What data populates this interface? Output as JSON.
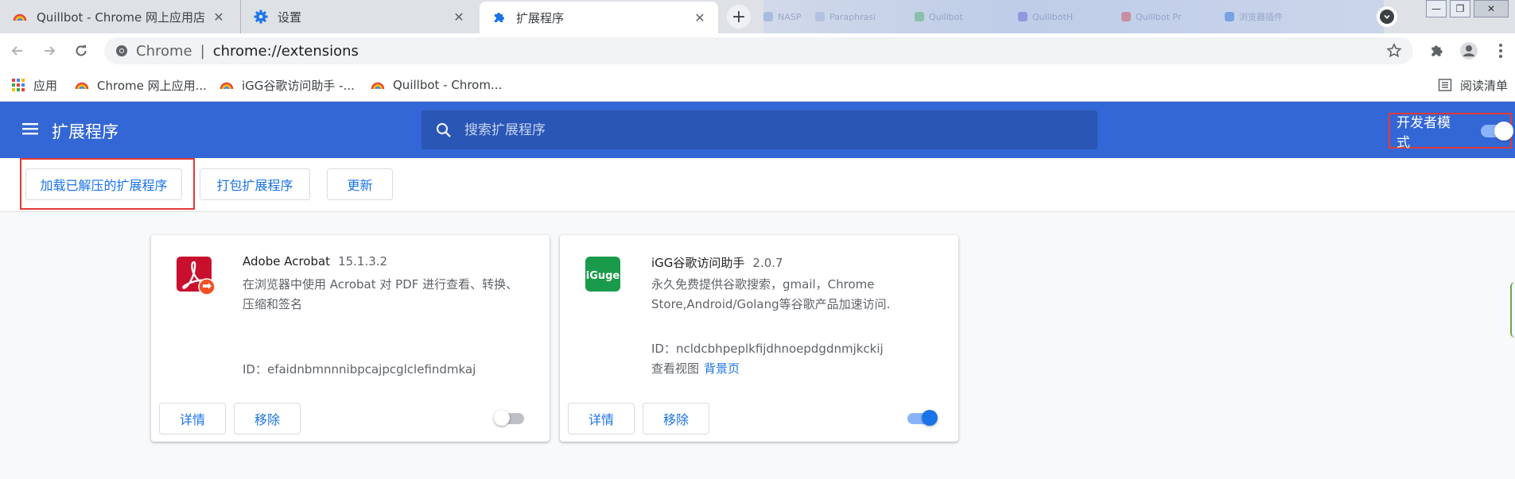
{
  "tabs": [
    {
      "label": "Quillbot - Chrome 网上应用店",
      "icon": "quillbot-rainbow-icon"
    },
    {
      "label": "设置",
      "icon": "gear-icon"
    },
    {
      "label": "扩展程序",
      "icon": "puzzle-icon",
      "active": true
    }
  ],
  "background_tabs": [
    "NASP",
    "Paraphrasi",
    "Quillbot",
    "QuillbotH",
    "Quillbot Pr",
    "浏览器插件"
  ],
  "address": {
    "site": "Chrome",
    "separator": "|",
    "url": "chrome://extensions"
  },
  "bookmarks": [
    {
      "label": "应用",
      "icon": "apps-grid-icon"
    },
    {
      "label": "Chrome 网上应用...",
      "icon": "rainbow-icon"
    },
    {
      "label": "iGG谷歌访问助手 -...",
      "icon": "rainbow-icon"
    },
    {
      "label": "Quillbot - Chrom...",
      "icon": "rainbow-icon"
    }
  ],
  "reading_list": "阅读清单",
  "header": {
    "title": "扩展程序",
    "search_placeholder": "搜索扩展程序",
    "dev_mode_label": "开发者模式",
    "dev_mode_on": true
  },
  "actions": {
    "load_unpacked": "加载已解压的扩展程序",
    "pack": "打包扩展程序",
    "update": "更新"
  },
  "extensions": [
    {
      "name": "Adobe Acrobat",
      "version": "15.1.3.2",
      "description": "在浏览器中使用 Acrobat 对 PDF 进行查看、转换、压缩和签名",
      "id": "ID：efaidnbmnnnibpcajpcglclefindmkaj",
      "details": "详情",
      "remove": "移除",
      "enabled": false
    },
    {
      "name": "iGG谷歌访问助手",
      "version": "2.0.7",
      "description": "永久免费提供谷歌搜索，gmail，Chrome Store,Android/Golang等谷歌产品加速访问.",
      "id": "ID：ncldcbhpeplkfijdhnoepdgdnmjkckij",
      "inspect_label": "查看视图",
      "inspect_link": "背景页",
      "icon_text": "iGuge",
      "details": "详情",
      "remove": "移除",
      "enabled": true
    }
  ],
  "colors": {
    "header_blue": "#3367d6",
    "accent": "#1a73e8",
    "highlight_red": "#e53935"
  }
}
